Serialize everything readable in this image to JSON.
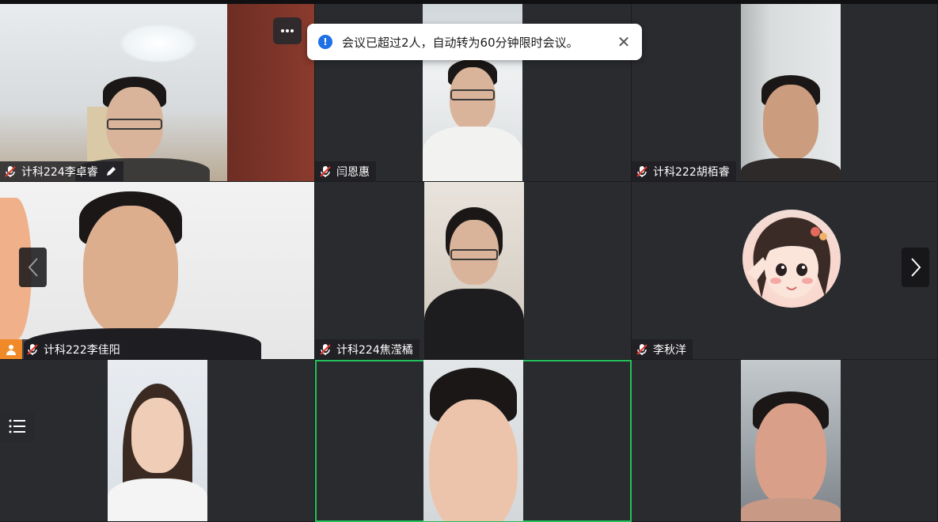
{
  "toast": {
    "message": "会议已超过2人，自动转为60分钟限时会议。",
    "icon": "info-icon",
    "close_icon": "close-icon"
  },
  "participants": [
    {
      "name": "计科224李卓睿",
      "muted": true,
      "editable": true
    },
    {
      "name": "闫恩惠",
      "muted": true
    },
    {
      "name": "计科222胡栢睿",
      "muted": true
    },
    {
      "name": "计科222李佳阳",
      "muted": true,
      "host": true
    },
    {
      "name": "计科224焦滢橘",
      "muted": true
    },
    {
      "name": "李秋洋",
      "muted": true,
      "avatar": true
    },
    {
      "name": "",
      "muted": true
    },
    {
      "name": "",
      "muted": true,
      "active_speaker": true
    },
    {
      "name": "",
      "muted": true
    }
  ],
  "controls": {
    "more_icon": "more-icon",
    "prev_icon": "chevron-left-icon",
    "next_icon": "chevron-right-icon",
    "list_icon": "list-icon"
  },
  "colors": {
    "background": "#1f2024",
    "active_border": "#22c35b",
    "host_badge": "#f08a28",
    "info_blue": "#1f6fe5"
  }
}
